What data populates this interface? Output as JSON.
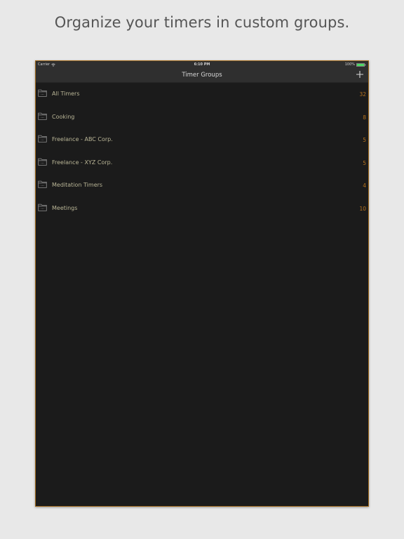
{
  "headline": "Organize your timers in custom groups.",
  "statusbar": {
    "carrier": "Carrier",
    "time": "6:10 PM",
    "battery": "100%",
    "wifi_icon": "wifi-icon",
    "battery_icon": "battery-icon"
  },
  "navbar": {
    "title": "Timer Groups",
    "add_icon": "plus-icon"
  },
  "groups": [
    {
      "label": "All Timers",
      "count": "32"
    },
    {
      "label": "Cooking",
      "count": "8"
    },
    {
      "label": "Freelance - ABC Corp.",
      "count": "5"
    },
    {
      "label": "Freelance - XYZ Corp.",
      "count": "5"
    },
    {
      "label": "Meditation Timers",
      "count": "4"
    },
    {
      "label": "Meetings",
      "count": "10"
    }
  ],
  "colors": {
    "accent": "#b8741f",
    "background": "#1b1b1b",
    "navbar": "#2f2f2f",
    "label": "#b9b596",
    "battery": "#4cd964"
  }
}
